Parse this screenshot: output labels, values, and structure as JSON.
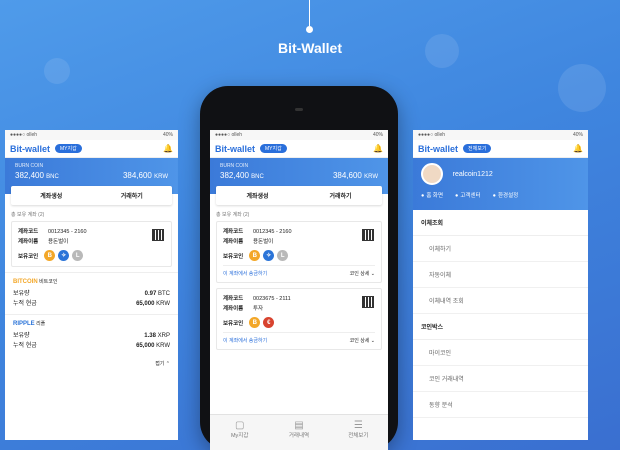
{
  "hero": {
    "title": "Bit-Wallet"
  },
  "status": {
    "carrier": "●●●●○ olleh",
    "battery": "40%"
  },
  "appbar": {
    "name": "Bit-wallet",
    "pill_my": "MY지갑",
    "pill_all": "전체보기"
  },
  "banner": {
    "coin_label": "BURN COIN",
    "bnc_value": "382,400",
    "bnc_unit": "BNC",
    "krw_value": "384,600",
    "krw_unit": "KRW"
  },
  "tabs": {
    "create": "계좌생성",
    "trade": "거래하기"
  },
  "accounts": {
    "label": "총 보유 계좌 (2)",
    "code_label": "계좌코드",
    "name_label": "계좌이름",
    "coins_label": "보유코인",
    "items": [
      {
        "code": "0012345 - 2160",
        "name": "용돈벌이"
      },
      {
        "code": "0023675 - 2111",
        "name": "투자"
      }
    ],
    "foot_link": "이 계좌에서 송금하기",
    "foot_detail": "코인 상세"
  },
  "assets": [
    {
      "name": "BITCOIN",
      "sub": "비트코인",
      "amount_label": "보유량",
      "amount": "0.97",
      "unit": "BTC",
      "cash_label": "누적 현금",
      "cash": "65,000",
      "cash_unit": "KRW"
    },
    {
      "name": "RIPPLE",
      "sub": "리플",
      "amount_label": "보유량",
      "amount": "1.38",
      "unit": "XRP",
      "cash_label": "누적 현금",
      "cash": "65,000",
      "cash_unit": "KRW"
    }
  ],
  "fold_label": "접기",
  "bottom_nav": [
    {
      "label": "My지갑"
    },
    {
      "label": "거래내역"
    },
    {
      "label": "전체보기"
    }
  ],
  "profile": {
    "username": "realcoin1212",
    "home": "홈 화면",
    "support": "고객센터",
    "settings": "환경설정"
  },
  "menu": {
    "group1": "이체조회",
    "item1": "이체하기",
    "item2": "자동이체",
    "item3": "이체내역 조회",
    "group2": "코인박스",
    "item4": "마이코인",
    "item5": "코인 거래내역",
    "item6": "동향 분석"
  }
}
